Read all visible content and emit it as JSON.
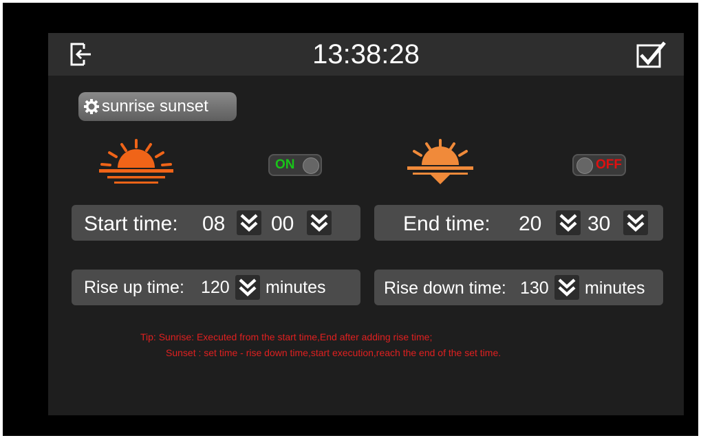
{
  "header": {
    "clock": "13:38:28"
  },
  "mode_button": {
    "label": "sunrise sunset"
  },
  "sunrise": {
    "toggle": {
      "state": "ON",
      "color": "#19c419"
    },
    "start_label": "Start time:",
    "start_hour": "08",
    "start_minute": "00",
    "rise_label": "Rise up time:",
    "rise_value": "120",
    "rise_unit": "minutes"
  },
  "sunset": {
    "toggle": {
      "state": "OFF",
      "color": "#e01010"
    },
    "end_label": "End time:",
    "end_hour": "20",
    "end_minute": "30",
    "fall_label": "Rise down time:",
    "fall_value": "130",
    "fall_unit": "minutes"
  },
  "tip": {
    "line1": "Tip: Sunrise: Executed from the start time,End after adding rise time;",
    "line2": "Sunset : set time - rise down time,start execution,reach the end of the set time."
  },
  "icons": {
    "exit": "exit-icon",
    "confirm": "checkbox-check-icon",
    "mode": "gear-icon",
    "sunrise": "sunrise-icon",
    "sunset": "sunset-icon",
    "dropdown": "double-chevron-down-icon"
  },
  "colors": {
    "sun": "#f06418",
    "sunset_sun": "#f08a3a",
    "tip": "#e02020"
  }
}
